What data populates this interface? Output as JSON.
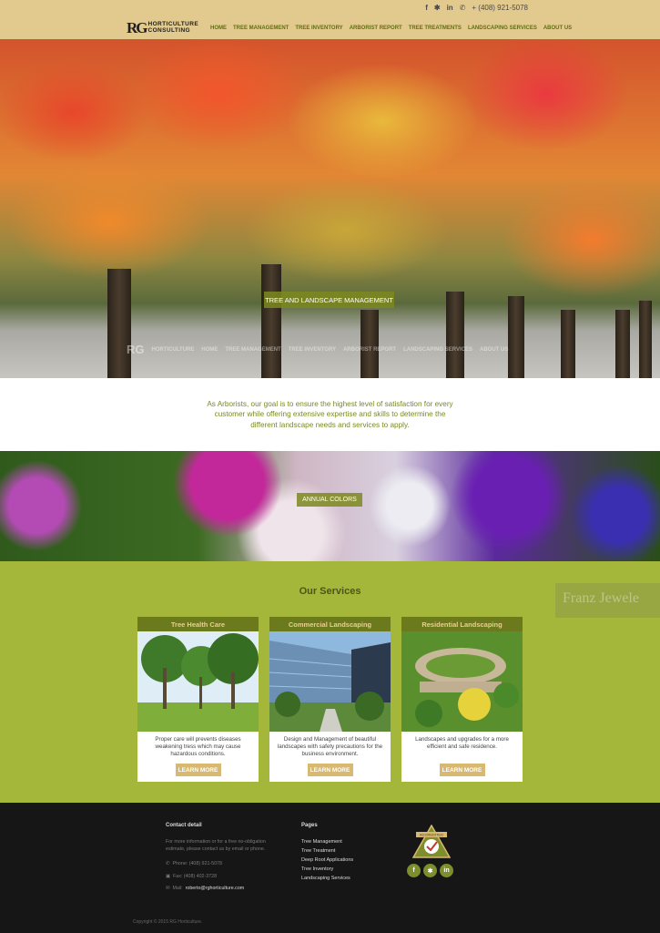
{
  "header": {
    "phone": "+ (408) 921-5078",
    "social": [
      "f",
      "yelp",
      "in"
    ],
    "logo_mark": "RG",
    "logo_line1": "HORTICULTURE",
    "logo_line2": "CONSULTING",
    "nav": [
      "HOME",
      "TREE MANAGEMENT",
      "TREE INVENTORY",
      "ARBORIST REPORT",
      "TREE TREATMENTS",
      "LANDSCAPING SERVICES",
      "ABOUT US"
    ]
  },
  "hero": {
    "button": "TREE AND LANDSCAPE MANAGEMENT"
  },
  "intro": {
    "text": "As Arborists, our goal is to ensure the highest level of satisfaction for every customer while offering extensive expertise and skills to determine the different landscape needs and services to apply."
  },
  "flowers": {
    "button": "ANNUAL COLORS"
  },
  "services": {
    "title": "Our Services",
    "background_sign": "Franz Jewele",
    "cards": [
      {
        "title": "Tree Health Care",
        "text": "Proper care will prevents diseases weakening tress which may cause hazardous conditions.",
        "button": "LEARN MORE"
      },
      {
        "title": "Commercial Landscaping",
        "text": "Design and Management of beautiful landscapes with safety precautions for the business environment.",
        "button": "LEARN MORE"
      },
      {
        "title": "Residential Landscaping",
        "text": "Landscapes and upgrades for a more efficient and safe residence.",
        "button": "LEARN MORE"
      }
    ]
  },
  "footer": {
    "contact_title": "Contact detail",
    "contact_text": "For more information or for a free no-obligation estimate, please contact us by email or phone.",
    "phone": "Phone: (408) 921-5078",
    "fax": "Fax: (408) 402-3728",
    "mail_label": "Mail:",
    "mail": "roberto@rghorticulture.com",
    "pages_title": "Pages",
    "pages": [
      "Tree Management",
      "Tree Treatment",
      "Deep Root Applications",
      "Tree Inventory",
      "Landscaping Services"
    ],
    "badge_label": "ACCREDITED",
    "social": [
      "f",
      "yelp",
      "in"
    ],
    "copyright": "Copyright © 2015 RG Horticulture."
  },
  "colors": {
    "header_bg": "#e2c98d",
    "nav_text": "#5f6e13",
    "services_bg": "#a5b73a",
    "card_head": "#6b7a1d",
    "button_tan": "#d9b970",
    "footer_bg": "#161616"
  }
}
